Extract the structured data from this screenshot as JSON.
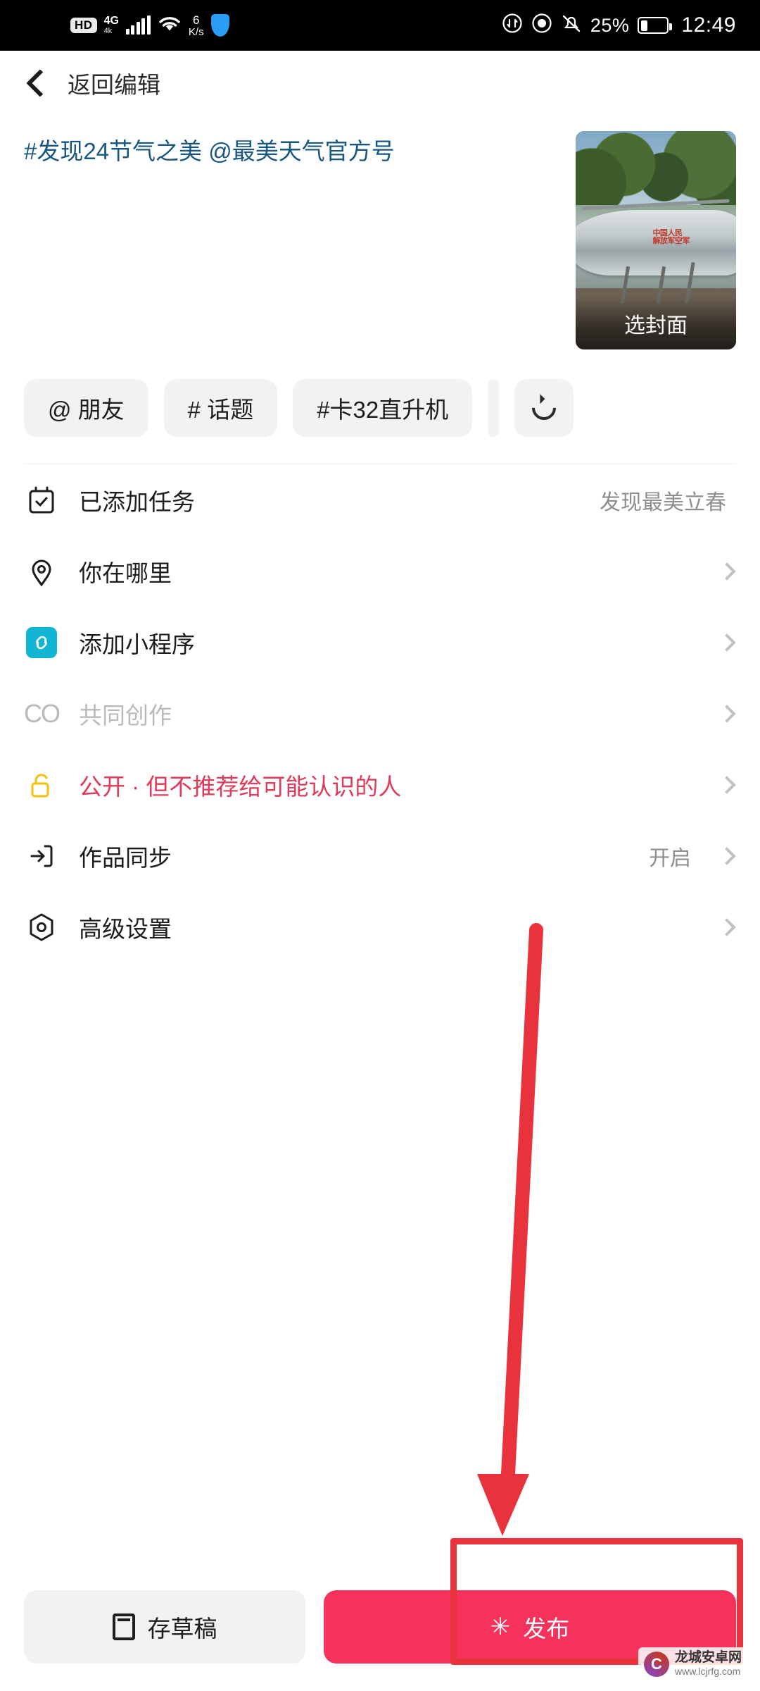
{
  "status_bar": {
    "hd_badge": "HD",
    "network_type": "4G",
    "network_sub": "4k",
    "data_rate_value": "6",
    "data_rate_unit": "K/s",
    "battery_percent": "25%",
    "time": "12:49",
    "icons": [
      "hd-icon",
      "signal-icon",
      "wifi-icon",
      "data-rate-icon",
      "shield-icon",
      "sync-icon",
      "eye-icon",
      "mute-icon",
      "battery-icon"
    ]
  },
  "nav": {
    "back_label": "返回编辑"
  },
  "compose": {
    "caption": "#发现24节气之美 @最美天气官方号",
    "cover_label": "选封面"
  },
  "chips": [
    {
      "label": "@ 朋友",
      "name": "chip-mention-friend"
    },
    {
      "label": "# 话题",
      "name": "chip-topic"
    },
    {
      "label": "#卡32直升机",
      "name": "chip-tag-ka32"
    },
    {
      "label": "",
      "name": "chip-refresh"
    }
  ],
  "list": [
    {
      "icon": "calendar-check-icon",
      "label": "已添加任务",
      "value": "发现最美立春",
      "chevron": false,
      "style": "normal"
    },
    {
      "icon": "location-pin-icon",
      "label": "你在哪里",
      "value": "",
      "chevron": true,
      "style": "normal"
    },
    {
      "icon": "mini-program-icon",
      "label": "添加小程序",
      "value": "",
      "chevron": true,
      "style": "normal"
    },
    {
      "icon": "co-create-icon",
      "label": "共同创作",
      "value": "",
      "chevron": true,
      "style": "disabled"
    },
    {
      "icon": "unlock-icon",
      "label": "公开 · 但不推荐给可能认识的人",
      "value": "",
      "chevron": true,
      "style": "privacy"
    },
    {
      "icon": "sync-works-icon",
      "label": "作品同步",
      "value": "开启",
      "chevron": true,
      "style": "normal"
    },
    {
      "icon": "advanced-settings-icon",
      "label": "高级设置",
      "value": "",
      "chevron": true,
      "style": "normal"
    }
  ],
  "bottom_bar": {
    "draft_label": "存草稿",
    "publish_label": "发布"
  },
  "watermark": {
    "line1": "龙城安卓网",
    "line2": "www.lcjrfg.com"
  },
  "colors": {
    "publish_accent": "#f5325b",
    "privacy_text": "#e03a5a",
    "caption_blue": "#18577f",
    "annotation_red": "#e8323c",
    "mini_program": "#13b5d4",
    "unlock_yellow": "#f0c419"
  }
}
